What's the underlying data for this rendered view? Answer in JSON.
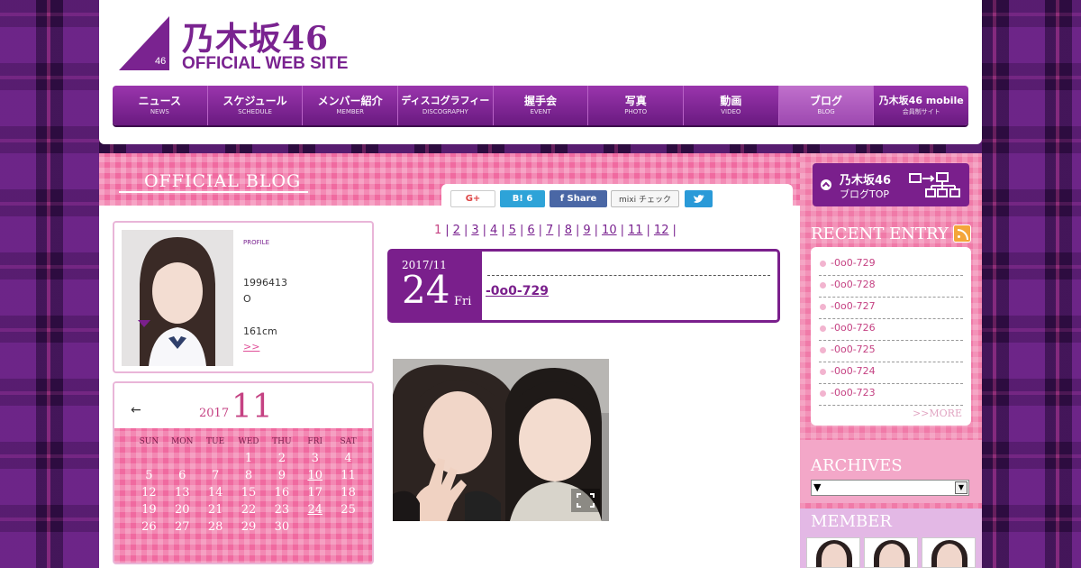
{
  "site": {
    "logo_title": "乃木坂46",
    "logo_sub": "OFFICIAL WEB SITE",
    "logo_46": "46"
  },
  "nav": [
    {
      "label": "ニュース",
      "sub": "NEWS"
    },
    {
      "label": "スケジュール",
      "sub": "SCHEDULE"
    },
    {
      "label": "メンバー紹介",
      "sub": "MEMBER"
    },
    {
      "label": "ディスコグラフィー",
      "sub": "DISCOGRAPHY"
    },
    {
      "label": "握手会",
      "sub": "EVENT"
    },
    {
      "label": "写真",
      "sub": "PHOTO"
    },
    {
      "label": "動画",
      "sub": "VIDEO"
    },
    {
      "label": "ブログ",
      "sub": "BLOG"
    },
    {
      "label": "乃木坂46 mobile",
      "sub": "会員制サイト"
    }
  ],
  "blog": {
    "title": "OFFICIAL BLOG"
  },
  "share": {
    "gplus": "G+",
    "hatena": "B! 6",
    "fb": "f  Share",
    "mixi": "mixi チェック",
    "twitter": "twitter-icon"
  },
  "profile": {
    "label": "PROFILE",
    "birthday": "1996413",
    "blood": "O",
    "height": "161cm",
    "more": ">>"
  },
  "calendar": {
    "prev": "←",
    "year": "2017",
    "month": "11",
    "dow": [
      "SUN",
      "MON",
      "TUE",
      "WED",
      "THU",
      "FRI",
      "SAT"
    ],
    "weeks": [
      [
        "",
        "",
        "",
        "1",
        "2",
        "3",
        "4"
      ],
      [
        "5",
        "6",
        "7",
        "8",
        "9",
        "10",
        "11"
      ],
      [
        "12",
        "13",
        "14",
        "15",
        "16",
        "17",
        "18"
      ],
      [
        "19",
        "20",
        "21",
        "22",
        "23",
        "24",
        "25"
      ],
      [
        "26",
        "27",
        "28",
        "29",
        "30",
        "",
        ""
      ]
    ],
    "linked_days": [
      "10",
      "24"
    ]
  },
  "pager": {
    "current": "1",
    "pages": [
      "2",
      "3",
      "4",
      "5",
      "6",
      "7",
      "8",
      "9",
      "10",
      "11",
      "12"
    ],
    "sep": "|"
  },
  "entry": {
    "year_month": "2017/11",
    "day": "24",
    "weekday": "Fri",
    "title": "-0o0-729"
  },
  "sidebar": {
    "top_btn_l1": "乃木坂46",
    "top_btn_l2": "ブログTOP",
    "recent_heading": "RECENT ENTRY",
    "recent": [
      "-0o0-729",
      "-0o0-728",
      "-0o0-727",
      "-0o0-726",
      "-0o0-725",
      "-0o0-724",
      "-0o0-723"
    ],
    "more": ">>MORE",
    "archives_heading": "ARCHIVES",
    "archive_value": "▼",
    "member_heading": "MEMBER"
  },
  "colors": {
    "brand_purple": "#7a1f8c",
    "pink": "#f06aa0"
  }
}
